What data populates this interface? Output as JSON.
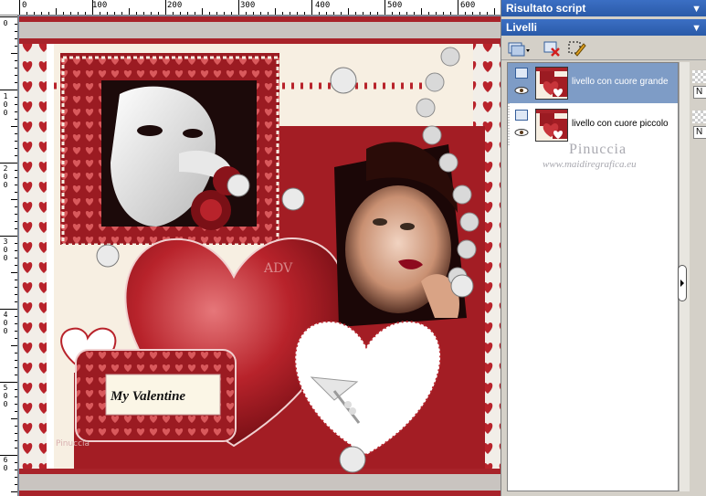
{
  "ruler": {
    "top_labels": [
      "0",
      "100",
      "200",
      "300",
      "400",
      "500",
      "600"
    ],
    "left_labels": [
      "0",
      "1 0 0",
      "2 0 0",
      "3 0 0",
      "4 0 0",
      "5 0 0",
      "6 0"
    ]
  },
  "canvas": {
    "label_text": "My Valentine",
    "tiny_credit": "Pinuccia",
    "ad_text": "ADV"
  },
  "panels": {
    "script_title": "Risultato script",
    "layers_title": "Livelli",
    "layers": [
      {
        "name": "livello con cuore grande",
        "selected": true
      },
      {
        "name": "livello con cuore piccolo",
        "selected": false
      }
    ],
    "watermark_name": "Pinuccia",
    "watermark_url": "www.maidiregrafica.eu",
    "prop_values": [
      "N",
      "N"
    ]
  },
  "colors": {
    "accent_blue": "#3b6fc4",
    "heart_red": "#b3222a",
    "dark_red": "#7a1016",
    "cream": "#f7efe2",
    "selected_row": "#7e9cc6"
  },
  "icons": {
    "pin": "pin-icon",
    "new_layer": "new-layer-icon",
    "delete_layer": "delete-layer-icon",
    "edit_selection": "edit-selection-icon",
    "visibility": "eye-icon"
  }
}
